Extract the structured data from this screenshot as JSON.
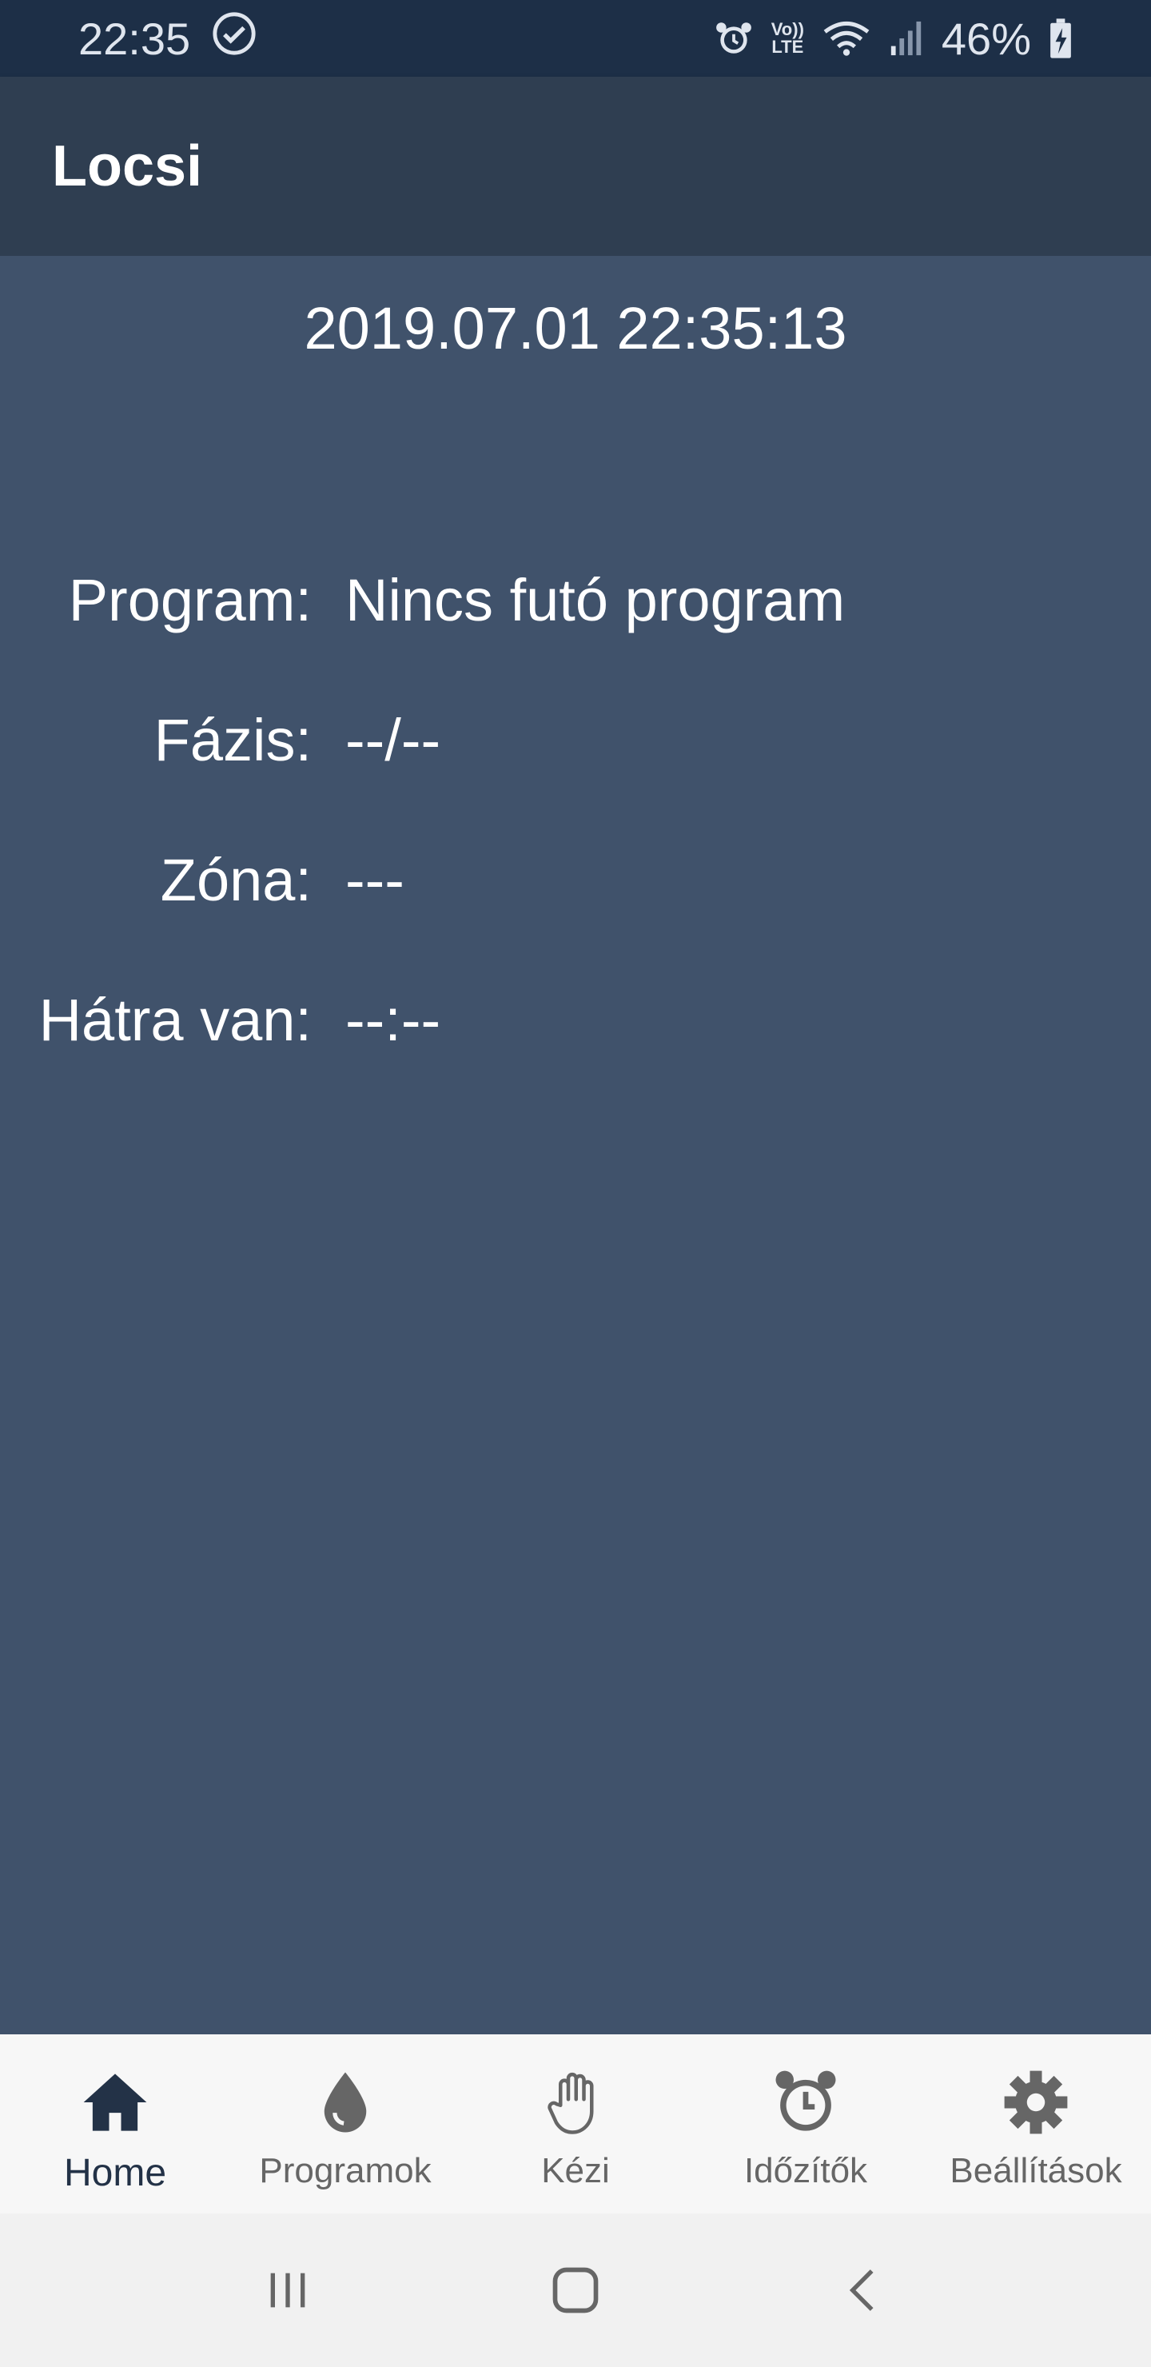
{
  "status_bar": {
    "time": "22:35",
    "volte_top": "Vo))",
    "volte_bottom": "LTE",
    "battery": "46%"
  },
  "app_bar": {
    "title": "Locsi"
  },
  "main": {
    "datetime": "2019.07.01 22:35:13",
    "rows": [
      {
        "label": "Program:",
        "value": "Nincs futó program"
      },
      {
        "label": "Fázis:",
        "value": "--/--"
      },
      {
        "label": "Zóna:",
        "value": "---"
      },
      {
        "label": "Hátra van:",
        "value": "--:--"
      }
    ]
  },
  "bottom_nav": {
    "tabs": [
      {
        "label": "Home",
        "icon": "home-icon",
        "active": true
      },
      {
        "label": "Programok",
        "icon": "water-drop-icon",
        "active": false
      },
      {
        "label": "Kézi",
        "icon": "hand-icon",
        "active": false
      },
      {
        "label": "Időzítők",
        "icon": "alarm-clock-icon",
        "active": false
      },
      {
        "label": "Beállítások",
        "icon": "gear-icon",
        "active": false
      }
    ]
  },
  "colors": {
    "status_bar": "#1d2f47",
    "app_bar": "#2f3e51",
    "background": "#40526b",
    "nav_background": "#f7f7f7",
    "active_tab": "#233247",
    "inactive_tab": "#666666"
  }
}
